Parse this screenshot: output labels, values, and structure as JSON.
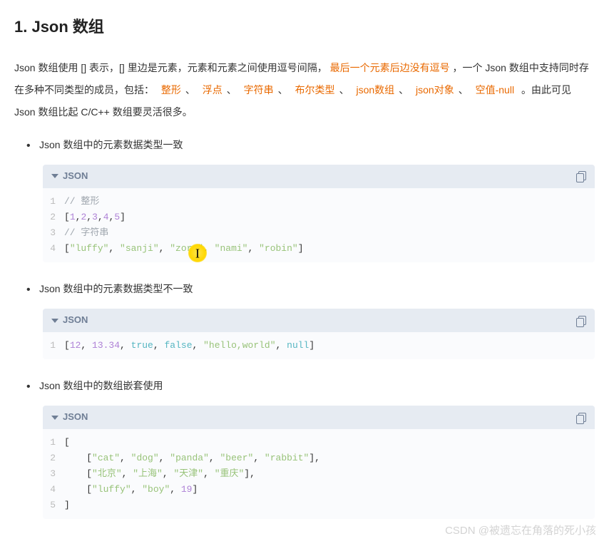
{
  "heading": "1. Json 数组",
  "intro": {
    "p1a": "Json 数组使用 [] 表示，[] 里边是元素，元素和元素之间使用逗号间隔，",
    "p1hl": "最后一个元素后边没有逗号",
    "p1b": "，一个 Json 数组中支持同时存在多种不同类型的成员，包括：",
    "types": [
      "整形",
      "浮点",
      "字符串",
      "布尔类型",
      "json数组",
      "json对象",
      "空值-null"
    ],
    "p1c": "。由此可见 Json 数组比起 C/C++ 数组要灵活很多。"
  },
  "bullets": {
    "b1": "Json 数组中的元素数据类型一致",
    "b2": "Json 数组中的元素数据类型不一致",
    "b3": "Json 数组中的数组嵌套使用"
  },
  "codeLang": "JSON",
  "code1": {
    "l1_comment": "// 整形",
    "l2_open": "[",
    "l2_nums": [
      "1",
      "2",
      "3",
      "4",
      "5"
    ],
    "l2_close": "]",
    "l3_comment": "// 字符串",
    "l4_open": "[",
    "l4_strs": [
      "\"luffy\"",
      "\"sanji\"",
      "\"zoro\"",
      "\"nami\"",
      "\"robin\""
    ],
    "l4_close": "]"
  },
  "code2": {
    "open": "[",
    "items": [
      {
        "txt": "12",
        "cls": "tok-num"
      },
      {
        "txt": "13.34",
        "cls": "tok-num"
      },
      {
        "txt": "true",
        "cls": "tok-bool"
      },
      {
        "txt": "false",
        "cls": "tok-bool"
      },
      {
        "txt": "\"hello,world\"",
        "cls": "tok-str"
      },
      {
        "txt": "null",
        "cls": "tok-null"
      }
    ],
    "close": "]"
  },
  "code3": {
    "r1": {
      "open": "[",
      "row": [
        "\"cat\"",
        "\"dog\"",
        "\"panda\"",
        "\"beer\"",
        "\"rabbit\""
      ]
    },
    "r2": {
      "open": "[",
      "row": [
        "\"北京\"",
        "\"上海\"",
        "\"天津\"",
        "\"重庆\""
      ]
    },
    "r3": {
      "open": "[",
      "mixed": [
        {
          "txt": "\"luffy\"",
          "cls": "tok-str"
        },
        {
          "txt": "\"boy\"",
          "cls": "tok-str"
        },
        {
          "txt": "19",
          "cls": "tok-num"
        }
      ]
    }
  },
  "watermark": "CSDN @被遗忘在角落的死小孩"
}
